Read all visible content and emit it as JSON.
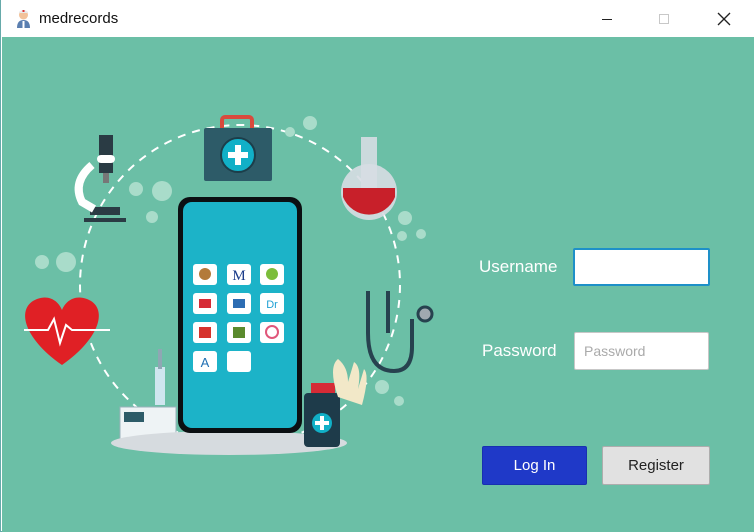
{
  "window": {
    "title": "medrecords",
    "icon": "doctor-avatar-icon",
    "controls": [
      "minimize-icon",
      "maximize-icon",
      "close-icon"
    ]
  },
  "illustration": {
    "icons": [
      "first-aid-kit-icon",
      "microscope-icon",
      "flask-icon",
      "heart-pulse-icon",
      "stethoscope-icon",
      "syringe-icon",
      "medicine-bottle-icon",
      "gloves-icon",
      "smartphone-icon"
    ],
    "phone_apps": [
      "M",
      "Dr",
      "A"
    ]
  },
  "login": {
    "username_label": "Username",
    "username_value": "",
    "password_label": "Password",
    "password_placeholder": "Password",
    "login_button": "Log In",
    "register_button": "Register"
  },
  "colors": {
    "background": "#6bbfa6",
    "login_button": "#1f39c8",
    "register_button": "#e1e1e1",
    "focus_border": "#1e90c8"
  }
}
